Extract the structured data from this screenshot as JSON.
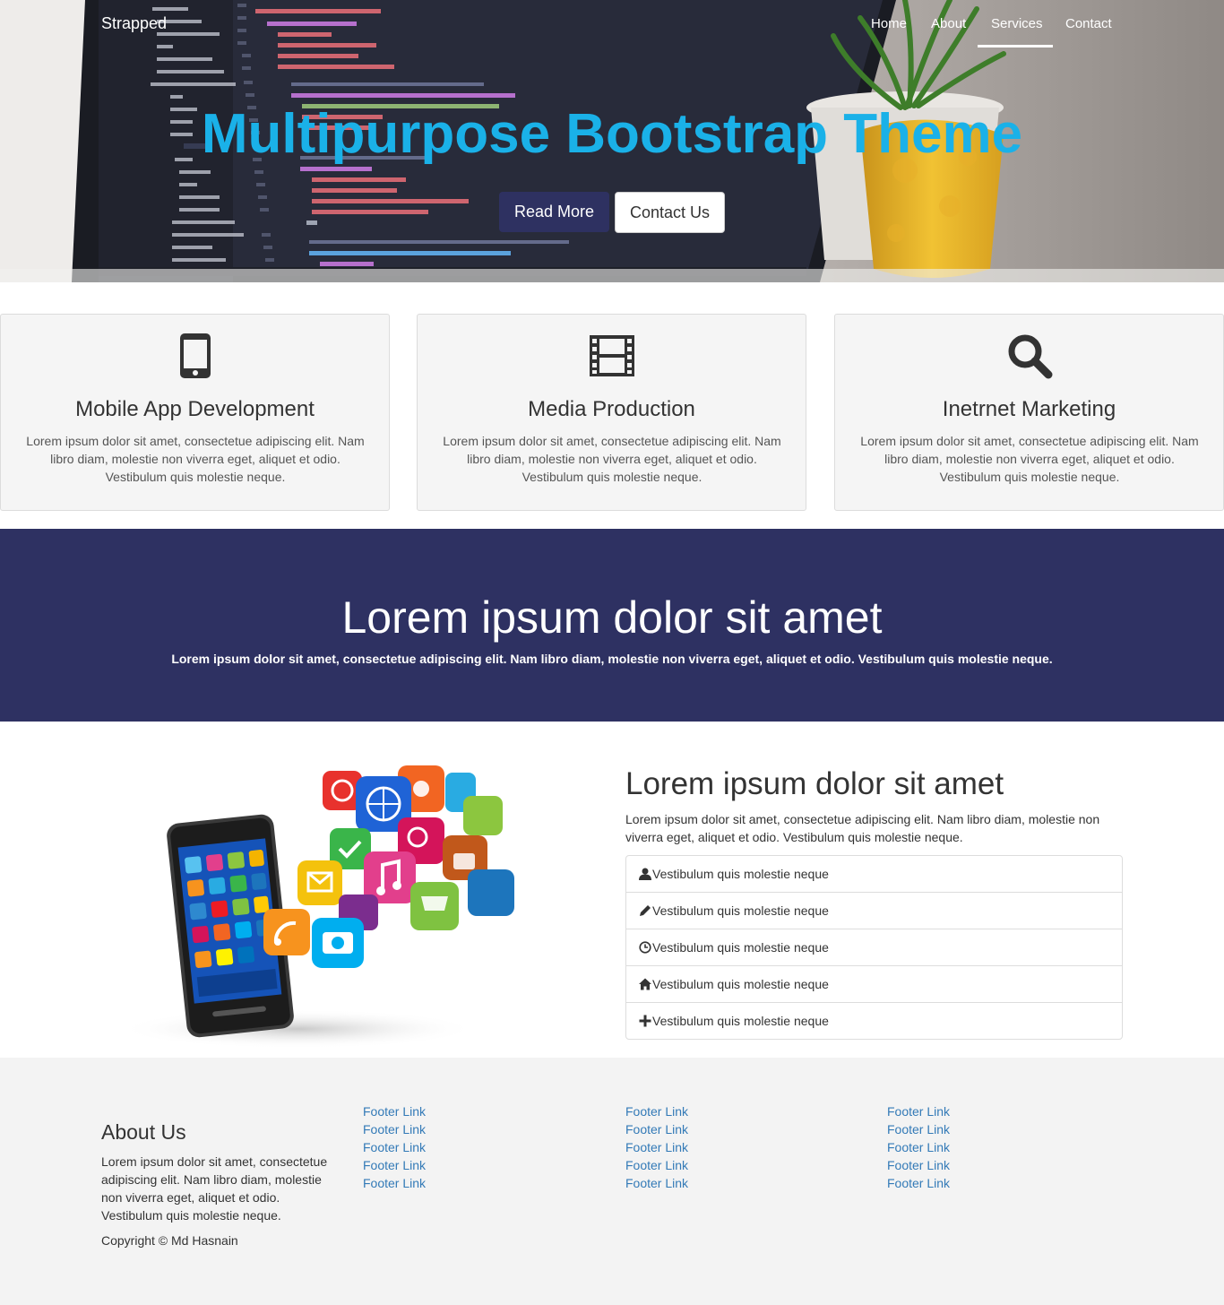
{
  "nav": {
    "brand": "Strapped",
    "items": [
      {
        "label": "Home"
      },
      {
        "label": "About"
      },
      {
        "label": "Services",
        "active": true
      },
      {
        "label": "Contact"
      }
    ]
  },
  "hero": {
    "title": "Multipurpose Bootstrap Theme",
    "read_more_label": "Read More",
    "contact_label": "Contact Us",
    "title_color": "#1ab1e8",
    "button_color": "#2e3161"
  },
  "features": [
    {
      "icon": "mobile-phone-icon",
      "title": "Mobile App Development",
      "text": "Lorem ipsum dolor sit amet, consectetue adipiscing elit. Nam libro diam, molestie non viverra eget, aliquet et odio. Vestibulum quis molestie neque."
    },
    {
      "icon": "film-icon",
      "title": "Media Production",
      "text": "Lorem ipsum dolor sit amet, consectetue adipiscing elit. Nam libro diam, molestie non viverra eget, aliquet et odio. Vestibulum quis molestie neque."
    },
    {
      "icon": "search-icon",
      "title": "Inetrnet Marketing",
      "text": "Lorem ipsum dolor sit amet, consectetue adipiscing elit. Nam libro diam, molestie non viverra eget, aliquet et odio. Vestibulum quis molestie neque."
    }
  ],
  "band": {
    "title": "Lorem ipsum dolor sit amet",
    "text": "Lorem ipsum dolor sit amet, consectetue adipiscing elit. Nam libro diam, molestie non viverra eget, aliquet et odio. Vestibulum quis molestie neque.",
    "background": "#2e3162"
  },
  "info": {
    "title": "Lorem ipsum dolor sit amet",
    "text": "Lorem ipsum dolor sit amet, consectetue adipiscing elit. Nam libro diam, molestie non viverra eget, aliquet et odio. Vestibulum quis molestie neque.",
    "list": [
      {
        "icon": "user-icon",
        "label": "Vestibulum quis molestie neque"
      },
      {
        "icon": "pencil-icon",
        "label": "Vestibulum quis molestie neque"
      },
      {
        "icon": "clock-icon",
        "label": "Vestibulum quis molestie neque"
      },
      {
        "icon": "home-icon",
        "label": "Vestibulum quis molestie neque"
      },
      {
        "icon": "plus-icon",
        "label": "Vestibulum quis molestie neque"
      }
    ]
  },
  "footer": {
    "about_title": "About Us",
    "about_text": "Lorem ipsum dolor sit amet, consectetue adipiscing elit. Nam libro diam, molestie non viverra eget, aliquet et odio. Vestibulum quis molestie neque.",
    "copyright": "Copyright © Md Hasnain",
    "link_label": "Footer Link",
    "columns": [
      [
        "Footer Link",
        "Footer Link",
        "Footer Link",
        "Footer Link",
        "Footer Link"
      ],
      [
        "Footer Link",
        "Footer Link",
        "Footer Link",
        "Footer Link",
        "Footer Link"
      ],
      [
        "Footer Link",
        "Footer Link",
        "Footer Link",
        "Footer Link",
        "Footer Link"
      ]
    ],
    "link_color": "#337ab7"
  }
}
